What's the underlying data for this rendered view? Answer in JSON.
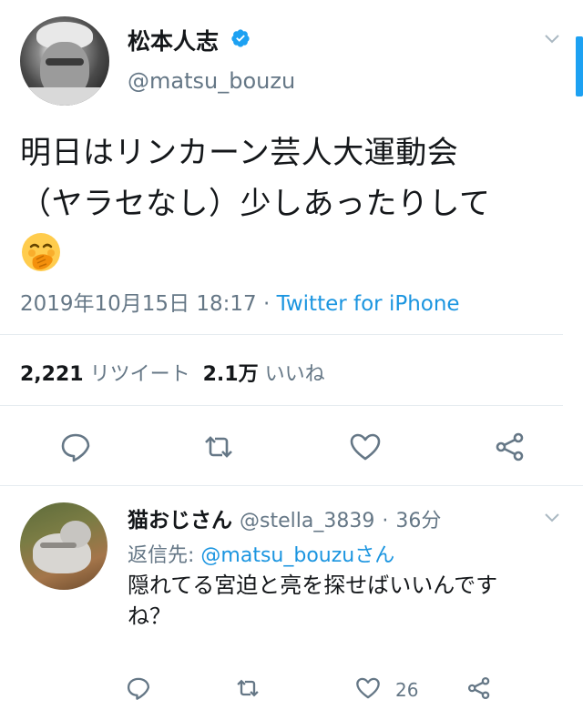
{
  "main_tweet": {
    "display_name": "松本人志",
    "handle": "@matsu_bouzu",
    "text_line1": "明日はリンカーン芸人大運動会",
    "text_line2": "（ヤラセなし）少しあったりして",
    "emoji_icon": "face-with-hand-over-mouth-icon",
    "timestamp": "2019年10月15日 18:17",
    "separator": "·",
    "via": "Twitter for iPhone",
    "retweet_count": "2,221",
    "retweet_label": "リツイート",
    "like_count": "2.1万",
    "like_label": "いいね"
  },
  "reply": {
    "display_name": "猫おじさん",
    "handle": "@stella_3839",
    "separator": "·",
    "time": "36分",
    "reply_to_prefix": "返信先:",
    "reply_to_handle": "@matsu_bouzu",
    "reply_to_suffix": "さん",
    "text_line1": "隠れてる宮迫と亮を探せばいいんです",
    "text_line2": "ね？",
    "like_count": "26"
  },
  "colors": {
    "accent": "#1da1f2",
    "link": "#1b95e0",
    "secondary_text": "#657786",
    "divider": "#e6ecf0",
    "icon": "#657786"
  }
}
